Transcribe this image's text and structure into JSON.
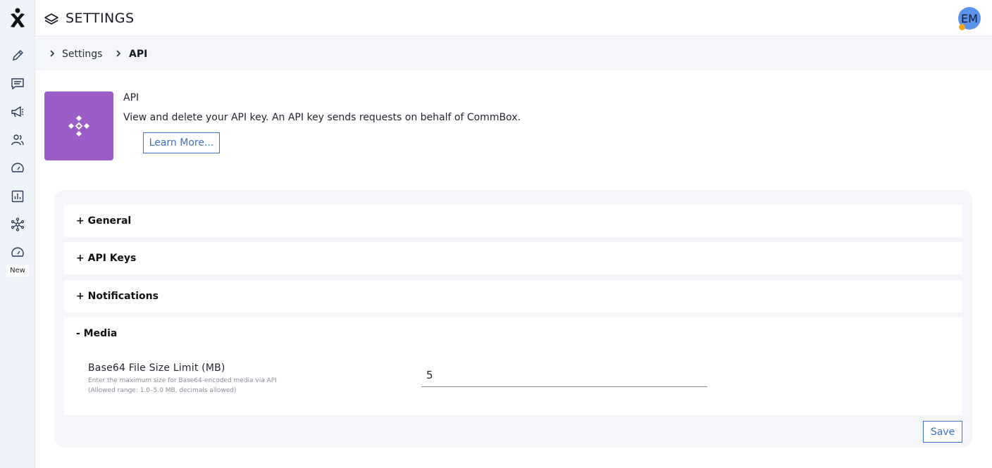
{
  "topbar": {
    "title": "SETTINGS",
    "user_initials": "EM"
  },
  "sidebar": {
    "items": [
      {
        "icon": "pencil-icon"
      },
      {
        "icon": "chat-icon"
      },
      {
        "icon": "megaphone-icon"
      },
      {
        "icon": "users-icon"
      },
      {
        "icon": "gauge-icon"
      },
      {
        "icon": "bar-chart-icon"
      },
      {
        "icon": "network-icon"
      },
      {
        "icon": "speedometer-icon"
      }
    ],
    "new_badge": "New"
  },
  "breadcrumb": {
    "items": [
      "Settings",
      "API"
    ]
  },
  "api": {
    "name": "API",
    "description": "View and delete your API key. An API key sends requests on behalf of CommBox.",
    "learn_more_label": "Learn More..."
  },
  "sections": [
    {
      "label": "+ General",
      "expanded": false
    },
    {
      "label": "+ API Keys",
      "expanded": false
    },
    {
      "label": "+ Notifications",
      "expanded": false
    },
    {
      "label": "- Media",
      "expanded": true,
      "fields": [
        {
          "label": "Base64 File Size Limit (MB)",
          "help_line1": "Enter the maximum size for Base64-encoded media via API",
          "help_line2": "(Allowed range: 1.0–5.0 MB, decimals allowed)",
          "value": "5"
        }
      ]
    }
  ],
  "save_label": "Save",
  "colors": {
    "accent": "#3b6fc9",
    "api_tile": "#9b5ec9",
    "avatar": "#5a93ec",
    "status_dot": "#f5a623"
  }
}
